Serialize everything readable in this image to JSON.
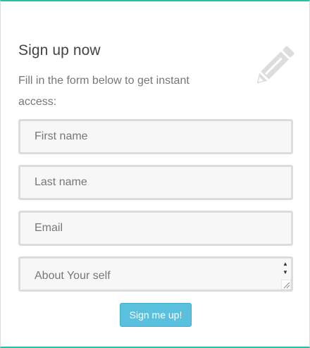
{
  "form": {
    "title": "Sign up now",
    "subtitle": "Fill in the form below to get instant access:",
    "decor_icon": "pencil-icon",
    "first_name": {
      "placeholder": "First name",
      "value": ""
    },
    "last_name": {
      "placeholder": "Last name",
      "value": ""
    },
    "email": {
      "placeholder": "Email",
      "value": ""
    },
    "about": {
      "placeholder": "About Your self",
      "value": ""
    },
    "submit_label": "Sign me up!"
  },
  "colors": {
    "accent": "#2bbfa4",
    "button": "#5bc0de",
    "field_bg": "#f7f7f7",
    "field_border": "#dcdcdc",
    "icon": "#dddddd"
  }
}
